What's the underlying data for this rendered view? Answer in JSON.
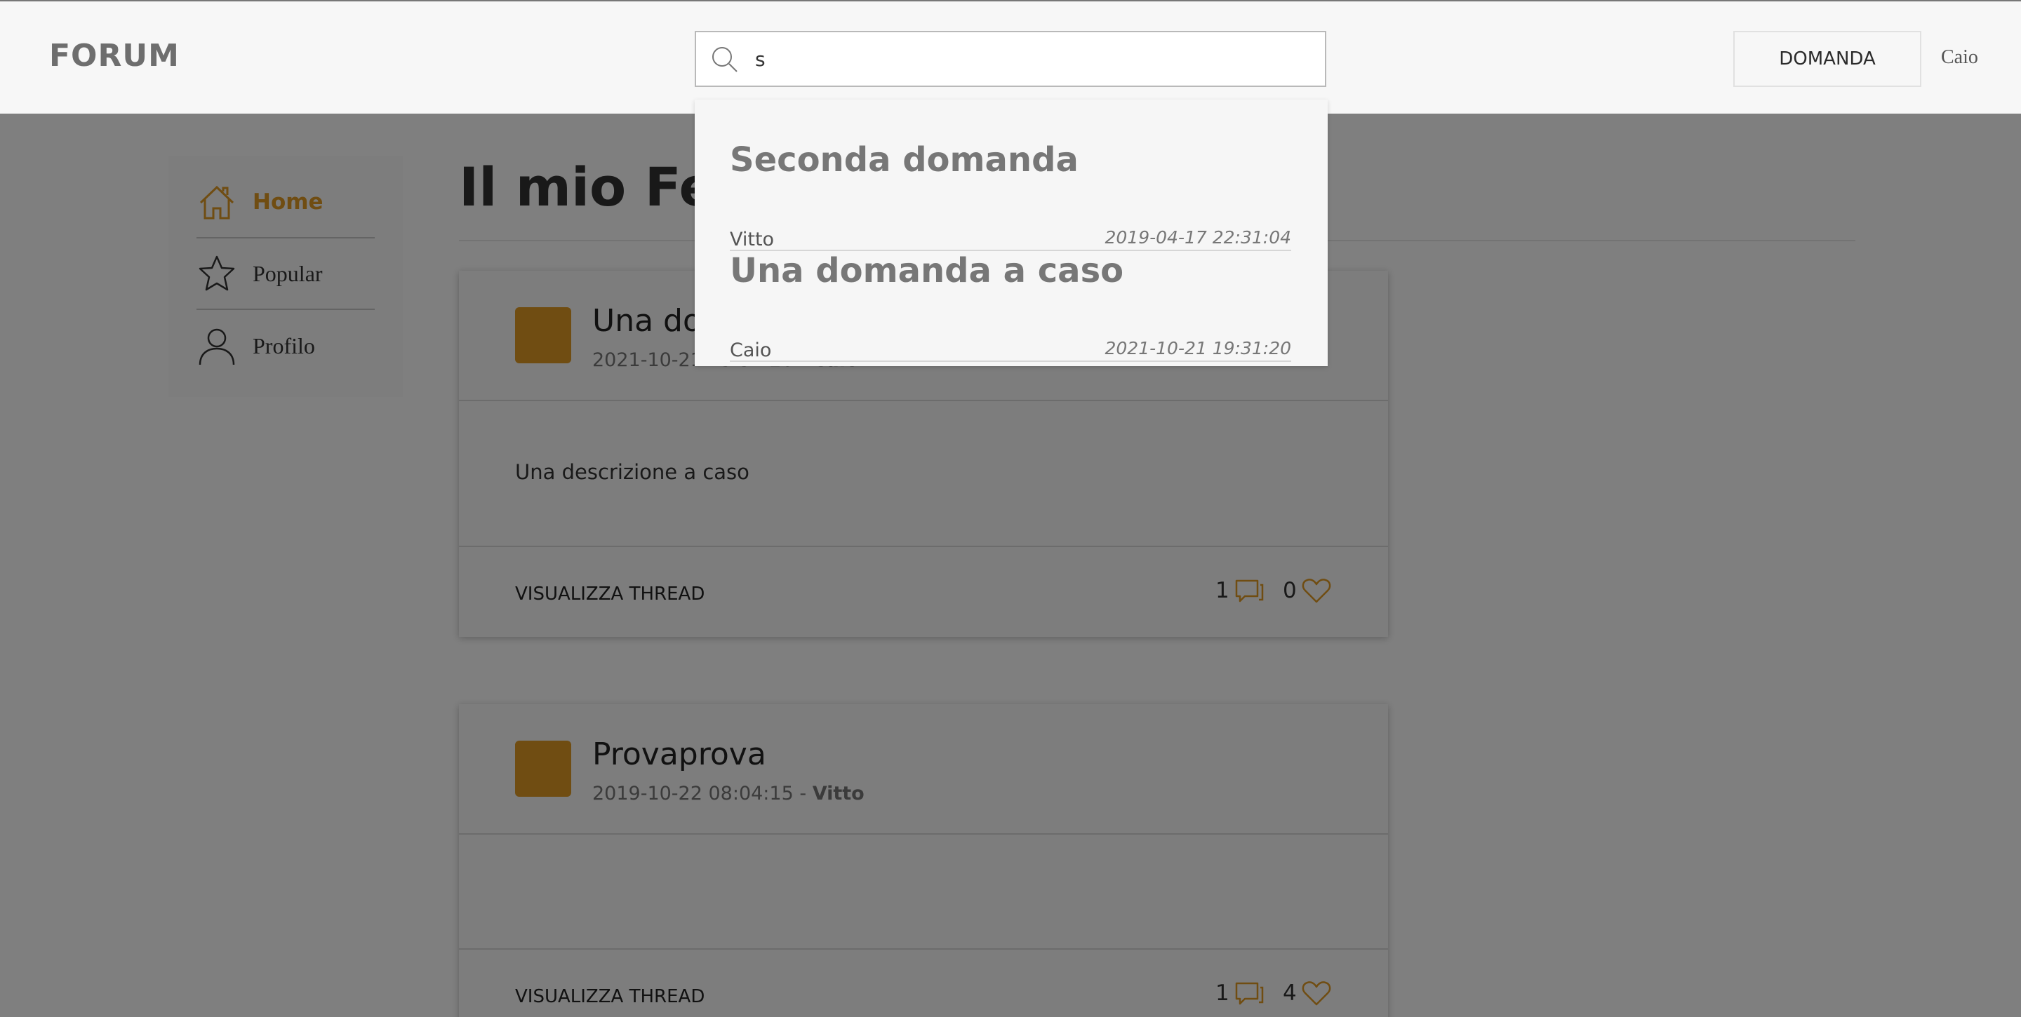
{
  "header": {
    "logo": "FORUM",
    "search_value": "s",
    "ask_button": "DOMANDA",
    "user": "Caio"
  },
  "sidebar": {
    "items": [
      {
        "label": "Home",
        "icon": "home-icon",
        "active": true
      },
      {
        "label": "Popular",
        "icon": "star-icon",
        "active": false
      },
      {
        "label": "Profilo",
        "icon": "user-icon",
        "active": false
      }
    ]
  },
  "main": {
    "title": "Il mio Feed",
    "threads": [
      {
        "title": "Una domanda a caso",
        "date": "2021-10-21 19:31:20",
        "separator": " - ",
        "author": "Caio",
        "description": "Una descrizione a caso",
        "action": "VISUALIZZA THREAD",
        "comments": "1",
        "likes": "0"
      },
      {
        "title": "Provaprova",
        "date": "2019-10-22 08:04:15",
        "separator": " - ",
        "author": "Vitto",
        "description": "",
        "action": "VISUALIZZA THREAD",
        "comments": "1",
        "likes": "4"
      }
    ]
  },
  "search_results": [
    {
      "title": "Seconda domanda",
      "author": "Vitto",
      "date": "2019-04-17 22:31:04"
    },
    {
      "title": "Una domanda a caso",
      "author": "Caio",
      "date": "2021-10-21 19:31:20"
    }
  ],
  "colors": {
    "accent": "#e09a24",
    "header_bg": "#f7f7f7",
    "overlay": "rgba(0,0,0,0.5)"
  }
}
